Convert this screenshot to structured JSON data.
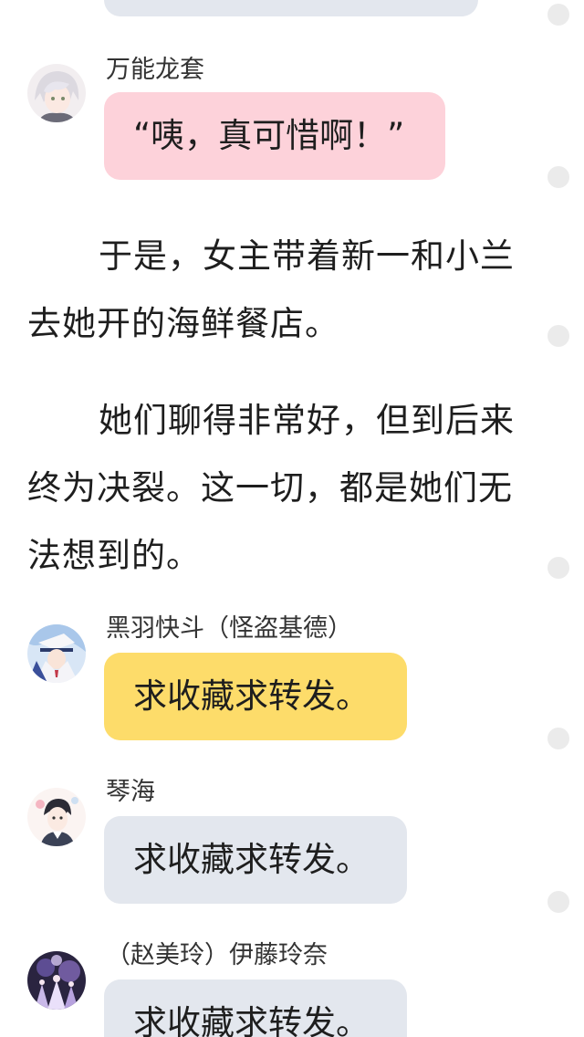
{
  "messages": [
    {
      "sender": "",
      "text": ""
    },
    {
      "sender": "万能龙套",
      "text": "“咦，真可惜啊！”"
    },
    {
      "sender": "黑羽快斗（怪盗基德）",
      "text": "求收藏求转发。"
    },
    {
      "sender": "琴海",
      "text": "求收藏求转发。"
    },
    {
      "sender": "（赵美玲）伊藤玲奈",
      "text": "求收藏求转发。"
    }
  ],
  "narration": [
    "于是，女主带着新一和小兰去她开的海鲜餐店。",
    "她们聊得非常好，但到后来终为决裂。这一切，都是她们无法想到的。"
  ],
  "colors": {
    "bubble_gray": "#e3e7ee",
    "bubble_pink": "#fdd2da",
    "bubble_yellow": "#fddc6a",
    "scroll_dot": "#ebebeb"
  },
  "avatars": [
    "anime-avatar-silver-hair",
    "anime-avatar-kaito-kid",
    "anime-avatar-kotomi",
    "anime-avatar-group-stage"
  ]
}
